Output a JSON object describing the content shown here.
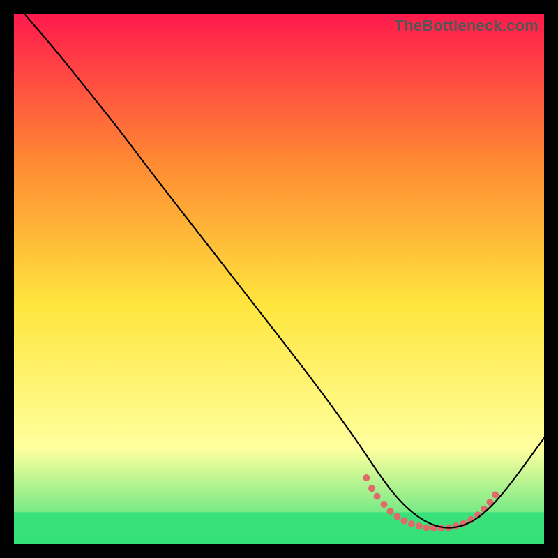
{
  "watermark": "TheBottleneck.com",
  "chart_data": {
    "type": "line",
    "title": "",
    "xlabel": "",
    "ylabel": "",
    "xlim": [
      0,
      100
    ],
    "ylim": [
      0,
      100
    ],
    "background_gradient": {
      "top": "#ff1a4d",
      "upper_mid": "#ff8a33",
      "mid": "#ffe63e",
      "lower": "#ffff9e",
      "bottom": "#34e07a"
    },
    "curve": {
      "name": "bottleneck-curve",
      "color": "#000000",
      "x": [
        2,
        8,
        14,
        20,
        26,
        33,
        40,
        47,
        54,
        60,
        65,
        69,
        72,
        75,
        78,
        81,
        84,
        87,
        90,
        93,
        96,
        100
      ],
      "y": [
        100,
        93,
        85.5,
        78,
        70,
        61,
        52,
        43,
        34,
        26,
        19,
        13,
        9,
        6,
        4,
        3,
        3.2,
        4.5,
        7,
        10.5,
        14.5,
        20
      ]
    },
    "dot_band": {
      "name": "optimal-range-dots",
      "color": "#e06a6a",
      "radius": 5,
      "points": [
        {
          "x": 66.5,
          "y": 12.5
        },
        {
          "x": 67.5,
          "y": 10.5
        },
        {
          "x": 68.5,
          "y": 9.0
        },
        {
          "x": 69.8,
          "y": 7.5
        },
        {
          "x": 71.0,
          "y": 6.2
        },
        {
          "x": 72.3,
          "y": 5.2
        },
        {
          "x": 73.6,
          "y": 4.4
        },
        {
          "x": 75.0,
          "y": 3.8
        },
        {
          "x": 76.4,
          "y": 3.4
        },
        {
          "x": 77.8,
          "y": 3.1
        },
        {
          "x": 79.2,
          "y": 3.0
        },
        {
          "x": 80.6,
          "y": 3.0
        },
        {
          "x": 82.0,
          "y": 3.1
        },
        {
          "x": 83.4,
          "y": 3.4
        },
        {
          "x": 84.8,
          "y": 3.9
        },
        {
          "x": 86.2,
          "y": 4.6
        },
        {
          "x": 87.5,
          "y": 5.5
        },
        {
          "x": 88.7,
          "y": 6.6
        },
        {
          "x": 89.8,
          "y": 7.9
        },
        {
          "x": 90.8,
          "y": 9.3
        }
      ]
    },
    "green_band": {
      "y_center": 3,
      "y_halfwidth": 3,
      "color": "#34e07a"
    }
  }
}
